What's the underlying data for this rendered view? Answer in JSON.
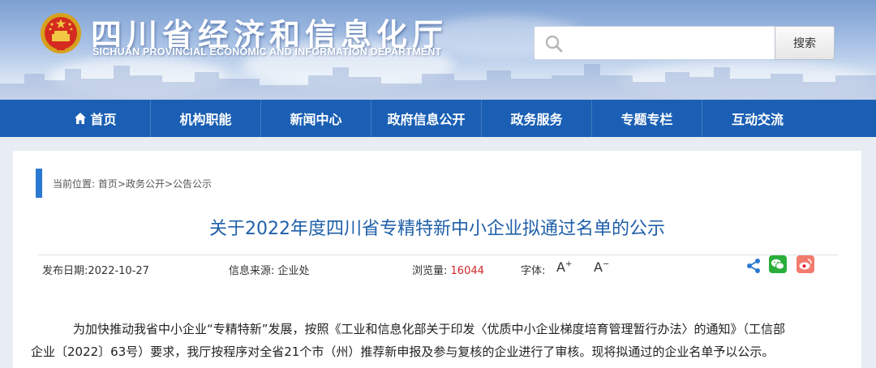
{
  "header": {
    "title": "四川省经济和信息化厅",
    "subtitle": "SICHUAN PROVINCIAL ECONOMIC AND INFORMATION DEPARTMENT",
    "emblem_icon": "national-emblem-icon"
  },
  "search": {
    "value": "",
    "placeholder": "",
    "button_label": "搜索",
    "icon": "search-icon"
  },
  "nav": {
    "items": [
      {
        "label": "首页",
        "icon": "home-icon"
      },
      {
        "label": "机构职能"
      },
      {
        "label": "新闻中心"
      },
      {
        "label": "政府信息公开"
      },
      {
        "label": "政务服务"
      },
      {
        "label": "专题专栏"
      },
      {
        "label": "互动交流"
      }
    ]
  },
  "breadcrumb": {
    "prefix": "当前位置:",
    "items": [
      "首页",
      "政务公开",
      "公告公示"
    ],
    "separator": ">"
  },
  "article": {
    "title": "关于2022年度四川省专精特新中小企业拟通过名单的公示",
    "publish_date_label": "发布日期:",
    "publish_date": "2022-10-27",
    "source_label": "信息来源:",
    "source": "企业处",
    "views_label": "浏览量:",
    "views": "16044",
    "font_label": "字体:",
    "font_up": "A",
    "font_up_sup": "+",
    "font_down": "A",
    "font_down_sup": "−",
    "paragraph_line1": "为加快推动我省中小企业“专精特新”发展，按照《工业和信息化部关于印发〈优质中小企业梯度培育管理暂行办法〉的通知》（工信部",
    "paragraph_line2": "企业〔2022〕63号）要求，我厅按程序对全省21个市（州）推荐新申报及参与复核的企业进行了审核。现将拟通过的企业名单予以公示。"
  },
  "colors": {
    "nav_bg": "#1a5fb4",
    "title_blue": "#1f5fa8",
    "views_red": "#d2242a",
    "wechat_green": "#2aae3a",
    "weibo_red": "#e6162d"
  }
}
